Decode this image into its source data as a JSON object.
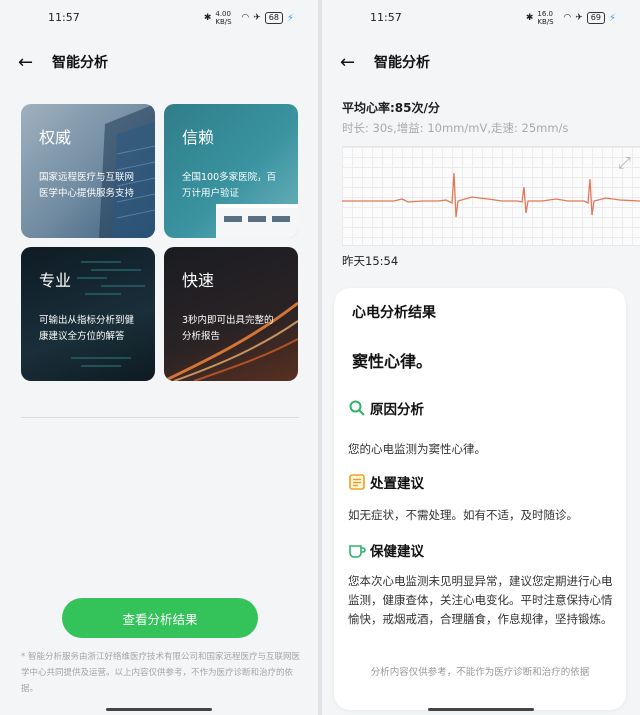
{
  "left": {
    "status": {
      "time": "11:57",
      "net_speed": "4.00 KB/S",
      "battery": "68"
    },
    "header": {
      "title": "智能分析"
    },
    "cards": [
      {
        "title": "权威",
        "desc": "国家远程医疗与互联网医学中心提供服务支持"
      },
      {
        "title": "信赖",
        "desc": "全国100多家医院，百万计用户验证"
      },
      {
        "title": "专业",
        "desc": "可输出从指标分析到健康建议全方位的解答"
      },
      {
        "title": "快速",
        "desc": "3秒内即可出具完整的分析报告"
      }
    ],
    "cta_label": "查看分析结果",
    "disclaimer": "* 智能分析服务由浙江好络维医疗技术有限公司和国家远程医疗与互联网医学中心共同提供及运营。以上内容仅供参考，不作为医疗诊断和治疗的依据。"
  },
  "right": {
    "status": {
      "time": "11:57",
      "net_speed": "16.0 KB/S",
      "battery": "69"
    },
    "header": {
      "title": "智能分析"
    },
    "avg_heart_rate": "平均心率:85次/分",
    "meta": "时长: 30s,增益: 10mm/mV,走速: 25mm/s",
    "record_time": "昨天15:54",
    "result_card": {
      "title": "心电分析结果",
      "result": "窦性心律。",
      "sections": [
        {
          "icon": "search-icon",
          "title": "原因分析",
          "text": "您的心电监测为窦性心律。"
        },
        {
          "icon": "note-icon",
          "title": "处置建议",
          "text": "如无症状，不需处理。如有不适，及时随诊。"
        },
        {
          "icon": "cup-icon",
          "title": "保健建议",
          "text": "您本次心电监测未见明显异常，建议您定期进行心电监测，健康查体，关注心电变化。平时注意保持心情愉快，戒烟戒酒，合理膳食，作息规律，坚持锻炼。"
        }
      ],
      "footer": "分析内容仅供参考，不能作为医疗诊断和治疗的依据"
    }
  },
  "colors": {
    "accent_green": "#34c25a",
    "ecg_line": "#e0795a",
    "icon_green": "#2fb26a",
    "icon_orange": "#f0a020"
  }
}
